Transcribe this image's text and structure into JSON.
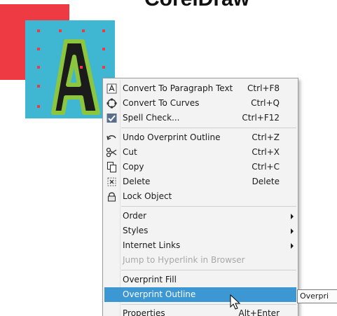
{
  "heading": "CorelDraw",
  "menu": {
    "items": [
      {
        "label": "Convert To Paragraph Text",
        "shortcut": "Ctrl+F8",
        "icon": "paragraph-text-icon"
      },
      {
        "label": "Convert To Curves",
        "shortcut": "Ctrl+Q",
        "icon": "curves-icon"
      },
      {
        "label": "Spell Check...",
        "shortcut": "Ctrl+F12",
        "icon": "spell-check-icon"
      },
      {
        "label": "Undo Overprint Outline",
        "shortcut": "Ctrl+Z",
        "icon": "undo-icon"
      },
      {
        "label": "Cut",
        "shortcut": "Ctrl+X",
        "icon": "scissors-icon"
      },
      {
        "label": "Copy",
        "shortcut": "Ctrl+C",
        "icon": "copy-icon"
      },
      {
        "label": "Delete",
        "shortcut": "Delete",
        "icon": "delete-icon"
      },
      {
        "label": "Lock Object",
        "shortcut": "",
        "icon": "lock-icon"
      },
      {
        "label": "Order",
        "submenu": true
      },
      {
        "label": "Styles",
        "submenu": true
      },
      {
        "label": "Internet Links",
        "submenu": true
      },
      {
        "label": "Jump to Hyperlink in Browser",
        "disabled": true
      },
      {
        "label": "Overprint Fill"
      },
      {
        "label": "Overprint Outline",
        "highlighted": true
      },
      {
        "label": "Properties",
        "shortcut": "Alt+Enter"
      }
    ]
  },
  "tooltip": "Overpri",
  "colors": {
    "highlight": "#3d97d3",
    "canvas_bg": "#3fb7d3",
    "letter_outline": "#8cc63f",
    "red_square": "#ee3a43"
  }
}
